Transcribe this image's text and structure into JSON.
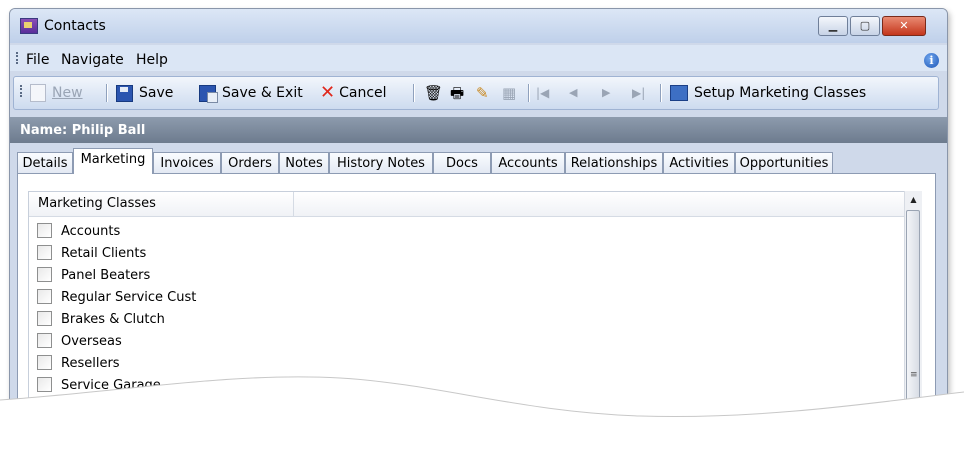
{
  "window": {
    "title": "Contacts",
    "min_label": "▁",
    "max_label": "▢",
    "close_label": "✕"
  },
  "menubar": {
    "items": [
      "File",
      "Navigate",
      "Help"
    ]
  },
  "toolbar": {
    "new_label": "New",
    "save_label": "Save",
    "save_exit_label": "Save & Exit",
    "cancel_label": "Cancel",
    "setup_label": "Setup Marketing Classes"
  },
  "contact": {
    "name_label": "Name: Philip Ball"
  },
  "tabs": [
    "Details",
    "Marketing",
    "Invoices",
    "Orders",
    "Notes",
    "History Notes",
    "Docs",
    "Accounts",
    "Relationships",
    "Activities",
    "Opportunities"
  ],
  "active_tab": "Marketing",
  "marketing": {
    "column_header": "Marketing Classes",
    "items": [
      "Accounts",
      "Retail Clients",
      "Panel Beaters",
      "Regular Service Cust",
      "Brakes & Clutch",
      "Overseas",
      "Resellers",
      "Service Garage"
    ]
  },
  "colors": {
    "close_button": "#c4361c",
    "name_bar": "#7d8b9e",
    "cancel_icon": "#e0271b"
  }
}
